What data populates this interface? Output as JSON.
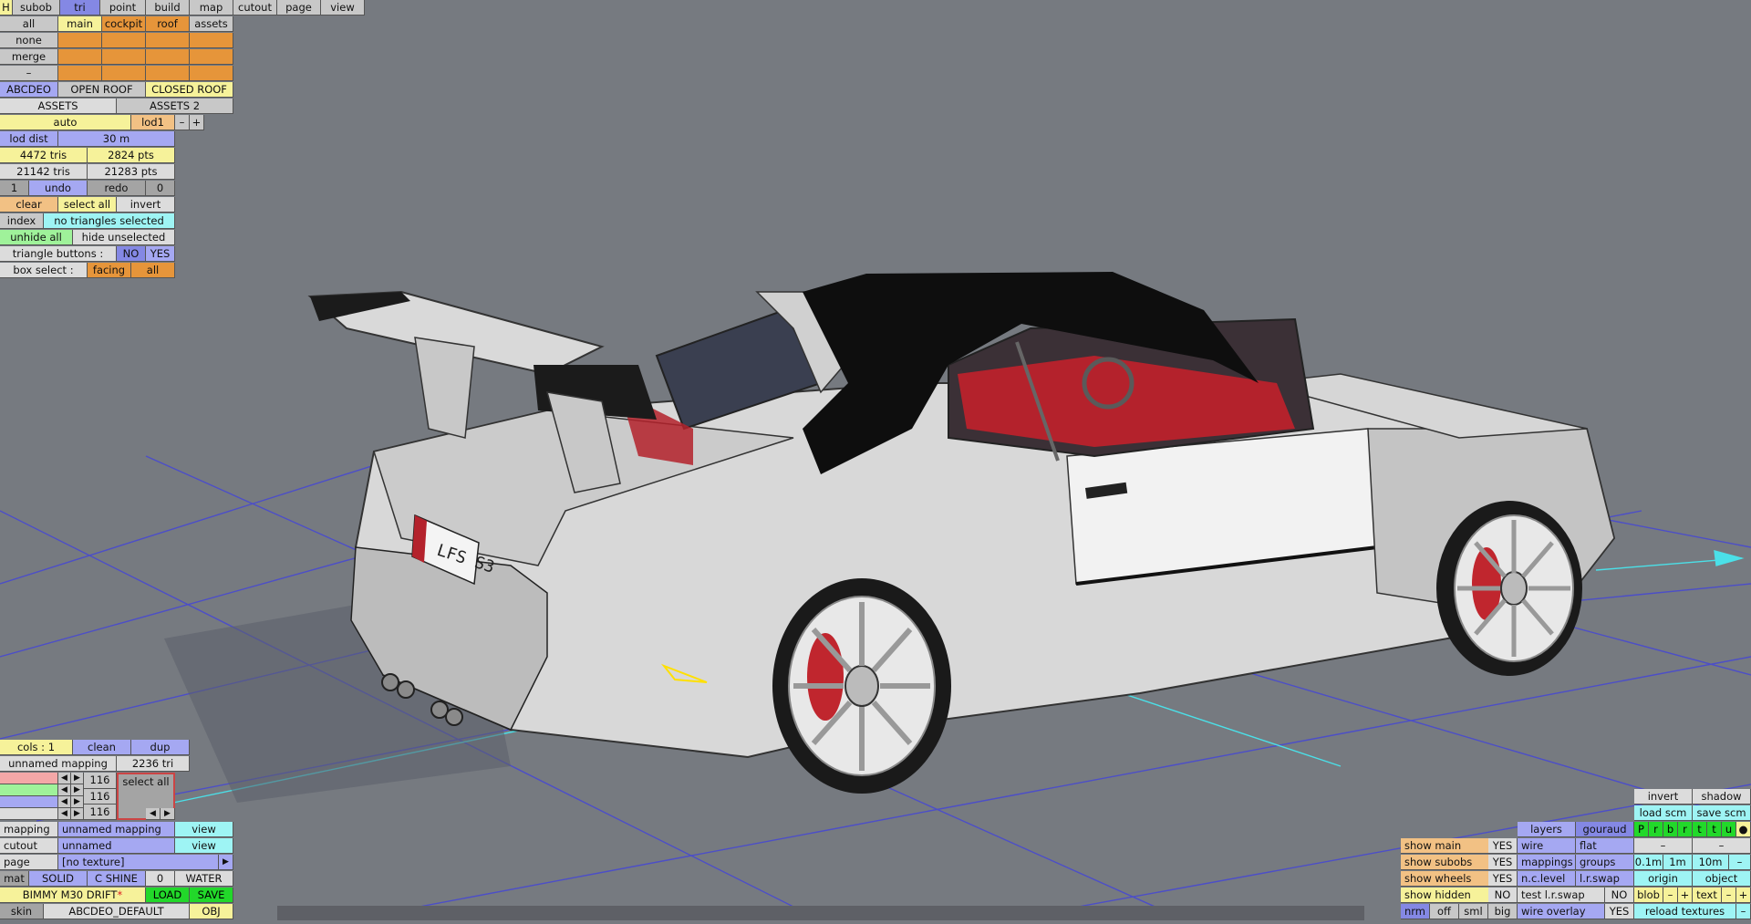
{
  "menu": [
    "H",
    "subob",
    "tri",
    "point",
    "build",
    "map",
    "cutout",
    "page",
    "view"
  ],
  "select": {
    "all": "all",
    "none": "none",
    "merge": "merge",
    "dash": "–"
  },
  "subob_tabs": [
    "main",
    "cockpit",
    "roof",
    "assets"
  ],
  "configs": {
    "a": "ABCDEO",
    "b": "OPEN ROOF",
    "c": "CLOSED ROOF"
  },
  "assets_tabs": {
    "a": "ASSETS",
    "b": "ASSETS 2"
  },
  "lod": {
    "mode": "auto",
    "name": "lod1",
    "minus": "–",
    "plus": "+",
    "dist_label": "lod dist",
    "dist_value": "30 m"
  },
  "counts": {
    "tris": "4472 tris",
    "pts": "2824 pts",
    "total_tris": "21142 tris",
    "total_pts": "21283 pts"
  },
  "history": {
    "count": "1",
    "undo": "undo",
    "redo": "redo",
    "redo_count": "0"
  },
  "selection": {
    "clear": "clear",
    "select_all": "select all",
    "invert": "invert",
    "index": "index",
    "status": "no triangles selected",
    "unhide_all": "unhide all",
    "hide_unselected": "hide unselected",
    "tri_buttons": "triangle buttons :",
    "no": "NO",
    "yes": "YES",
    "box_select": "box select :",
    "facing": "facing",
    "all": "all"
  },
  "cols": {
    "label": "cols : 1",
    "clean": "clean",
    "dup": "dup",
    "mapping_name": "unnamed mapping",
    "tri_count": "2236 tri",
    "rows": [
      "116",
      "116",
      "116"
    ],
    "select_all": "select all"
  },
  "props": {
    "mapping_label": "mapping",
    "mapping_value": "unnamed mapping",
    "mapping_view": "view",
    "cutout_label": "cutout",
    "cutout_value": "unnamed",
    "cutout_view": "view",
    "page_label": "page",
    "page_value": "[no texture]",
    "mat_label": "mat",
    "solid": "SOLID",
    "cshine": "C SHINE",
    "zero": "0",
    "water": "WATER",
    "car_name": "BIMMY M30 DRIFT",
    "asterisk": "*",
    "load": "LOAD",
    "save": "SAVE",
    "skin_label": "skin",
    "skin_value": "ABCDEO_DEFAULT",
    "obj": "OBJ"
  },
  "view_panel": {
    "invert": "invert",
    "shadow": "shadow",
    "load_scm": "load scm",
    "save_scm": "save scm",
    "flags": [
      "P",
      "r",
      "b",
      "r",
      "t",
      "t",
      "u"
    ],
    "layers": "layers",
    "gouraud": "gouraud",
    "wire": "wire",
    "flat": "flat",
    "mappings": "mappings",
    "groups": "groups",
    "nclevel": "n.c.level",
    "lrswap": "l.r.swap",
    "test_lrswap": "test l.r.swap",
    "wire_overlay": "wire overlay",
    "show_main": "show main",
    "show_subobs": "show subobs",
    "show_wheels": "show wheels",
    "show_hidden": "show hidden",
    "yes": "YES",
    "no": "NO",
    "scale": [
      "0.1m",
      "1m",
      "10m"
    ],
    "origin": "origin",
    "object": "object",
    "blob": "blob",
    "text": "text",
    "minus": "–",
    "plus": "+",
    "nrm": "nrm",
    "off": "off",
    "sml": "sml",
    "big": "big",
    "reload": "reload textures",
    "dash": "–"
  },
  "car": {
    "plate": "LFS S3"
  },
  "colors": {
    "background": "#767a80",
    "grid": "#4c4ec8",
    "axis": "#4be0e8",
    "body": "#dcdcdc",
    "roof": "#0e0e0e",
    "interior": "#b4222c"
  }
}
